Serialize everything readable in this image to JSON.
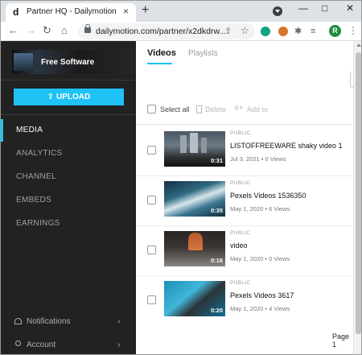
{
  "browser": {
    "tab": {
      "favicon": "d",
      "title": "Partner HQ - Dailymotion",
      "close": "×"
    },
    "new_tab": "+",
    "url": "dailymotion.com/partner/x2dkdrw...",
    "avatar_letter": "R"
  },
  "sidebar": {
    "logo_text": "Free Software",
    "upload_label": "UPLOAD",
    "nav": [
      {
        "label": "MEDIA",
        "active": true
      },
      {
        "label": "ANALYTICS",
        "active": false
      },
      {
        "label": "CHANNEL",
        "active": false
      },
      {
        "label": "EMBEDS",
        "active": false
      },
      {
        "label": "EARNINGS",
        "active": false
      }
    ],
    "notifications_label": "Notifications",
    "account_label": "Account"
  },
  "main": {
    "tabs": {
      "videos": "Videos",
      "playlists": "Playlists"
    },
    "actions": {
      "select_all": "Select all",
      "delete": "Delete",
      "add_to": "Add to"
    },
    "videos": [
      {
        "visibility": "PUBLIC",
        "title": "LISTOFFREEWARE shaky video 1",
        "duration": "0:31",
        "meta": "Jul 3, 2021 • 0 Views"
      },
      {
        "visibility": "PUBLIC",
        "title": "Pexels Videos 1536350",
        "duration": "0:35",
        "meta": "May 1, 2020 • 6 Views"
      },
      {
        "visibility": "PUBLIC",
        "title": "video",
        "duration": "0:16",
        "meta": "May 1, 2020 • 0 Views"
      },
      {
        "visibility": "PUBLIC",
        "title": "Pexels Videos 3617",
        "duration": "0:20",
        "meta": "May 1, 2020 • 4 Views"
      }
    ],
    "pager": "Page 1"
  },
  "colors": {
    "accent": "#1ec2f5",
    "sidebar_bg": "#222222"
  }
}
